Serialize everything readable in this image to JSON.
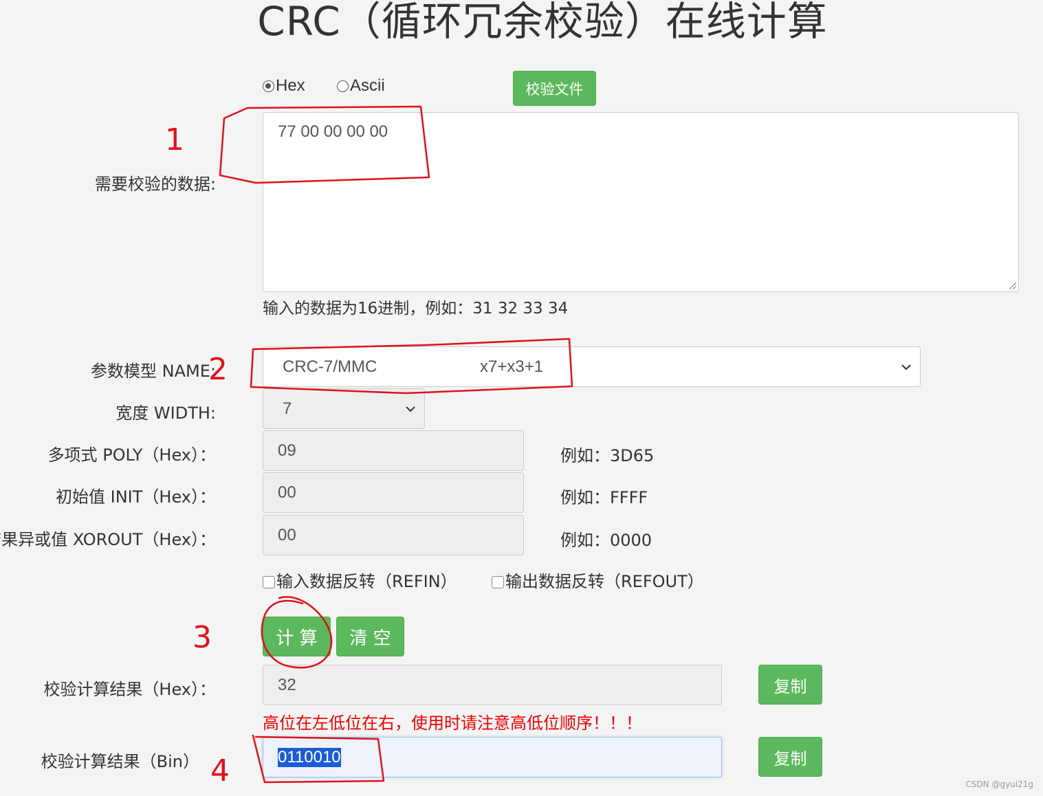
{
  "page": {
    "title": "CRC（循环冗余校验）在线计算"
  },
  "input_mode": {
    "hex_label": "Hex",
    "ascii_label": "Ascii",
    "selected": "Hex"
  },
  "verify_file_button": "校验文件",
  "data_input": {
    "label": "需要校验的数据:",
    "value": "77 00 00 00 00",
    "hint": "输入的数据为16进制，例如：31 32 33 34"
  },
  "param_model": {
    "label": "参数模型 NAME:",
    "name": "CRC-7/MMC",
    "poly_formula": "x7+x3+1"
  },
  "width": {
    "label": "宽度 WIDTH:",
    "value": "7"
  },
  "poly": {
    "label": "多项式 POLY（Hex）：",
    "value": "09",
    "example": "例如：3D65"
  },
  "init": {
    "label": "初始值 INIT（Hex）：",
    "value": "00",
    "example": "例如：FFFF"
  },
  "xorout": {
    "label": "结果异或值 XOROUT（Hex）：",
    "value": "00",
    "example": "例如：0000"
  },
  "refin": {
    "label": "输入数据反转（REFIN）",
    "checked": false
  },
  "refout": {
    "label": "输出数据反转（REFOUT）",
    "checked": false
  },
  "actions": {
    "calculate": "计 算",
    "clear": "清 空"
  },
  "result_hex": {
    "label": "校验计算结果（Hex）：",
    "value": "32",
    "copy": "复制"
  },
  "warning": "高位在左低位在右，使用时请注意高低位顺序！！！",
  "result_bin": {
    "label": "校验计算结果（Bin）",
    "value": "0110010",
    "copy": "复制"
  },
  "annotations": [
    "1",
    "2",
    "3",
    "4"
  ],
  "colors": {
    "accent_green": "#5cb85c",
    "annotation_red": "#e0101a",
    "warning_red": "#ee0000",
    "selection_blue": "#1a5bd6"
  },
  "watermark": "CSDN @gyui21g"
}
